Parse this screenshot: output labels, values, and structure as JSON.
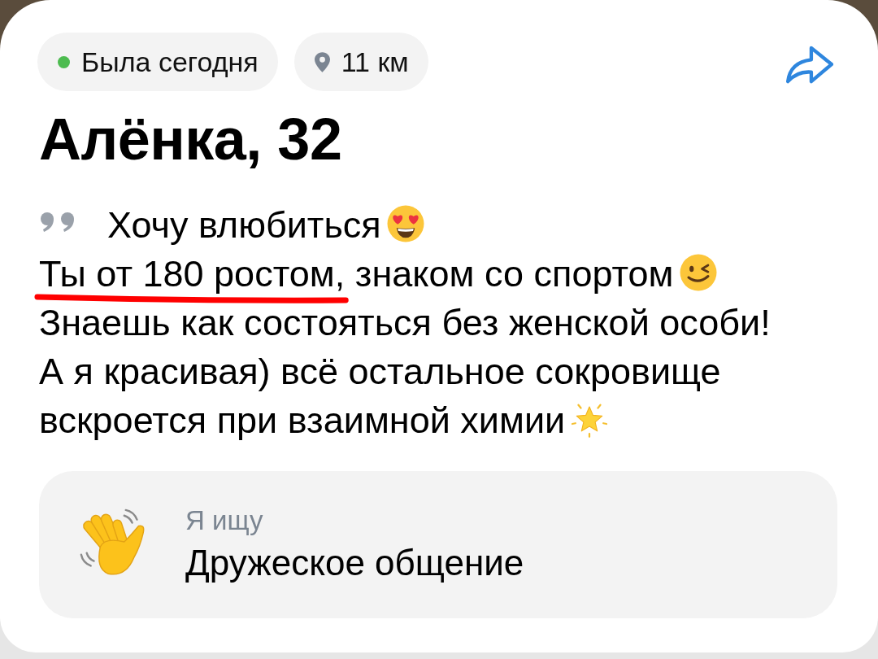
{
  "status_chips": [
    {
      "kind": "presence",
      "text": "Была сегодня"
    },
    {
      "kind": "distance",
      "text": "11 км"
    }
  ],
  "profile": {
    "name_age": "Алёнка, 32"
  },
  "bio": {
    "lines": [
      {
        "parts": [
          {
            "kind": "text",
            "text": "Хочу влюбиться",
            "underlined": false
          },
          {
            "kind": "heart-eyes-emoji"
          }
        ]
      },
      {
        "parts": [
          {
            "kind": "text",
            "text": "Ты от 180 ростом,",
            "underlined": true
          },
          {
            "kind": "text",
            "text": "знаком со спортом",
            "underlined": false
          },
          {
            "kind": "wink-emoji"
          }
        ]
      },
      {
        "parts": [
          {
            "kind": "text",
            "text": "Знаешь как состояться без женской особи!",
            "underlined": false
          }
        ]
      },
      {
        "parts": [
          {
            "kind": "text",
            "text": "А я красивая) всё остальное сокровище",
            "underlined": false
          }
        ]
      },
      {
        "parts": [
          {
            "kind": "text",
            "text": "вскроется при взаимной химии",
            "underlined": false
          },
          {
            "kind": "star-emoji"
          }
        ]
      }
    ]
  },
  "looking_for": {
    "label": "Я ищу",
    "value": "Дружеское общение"
  }
}
